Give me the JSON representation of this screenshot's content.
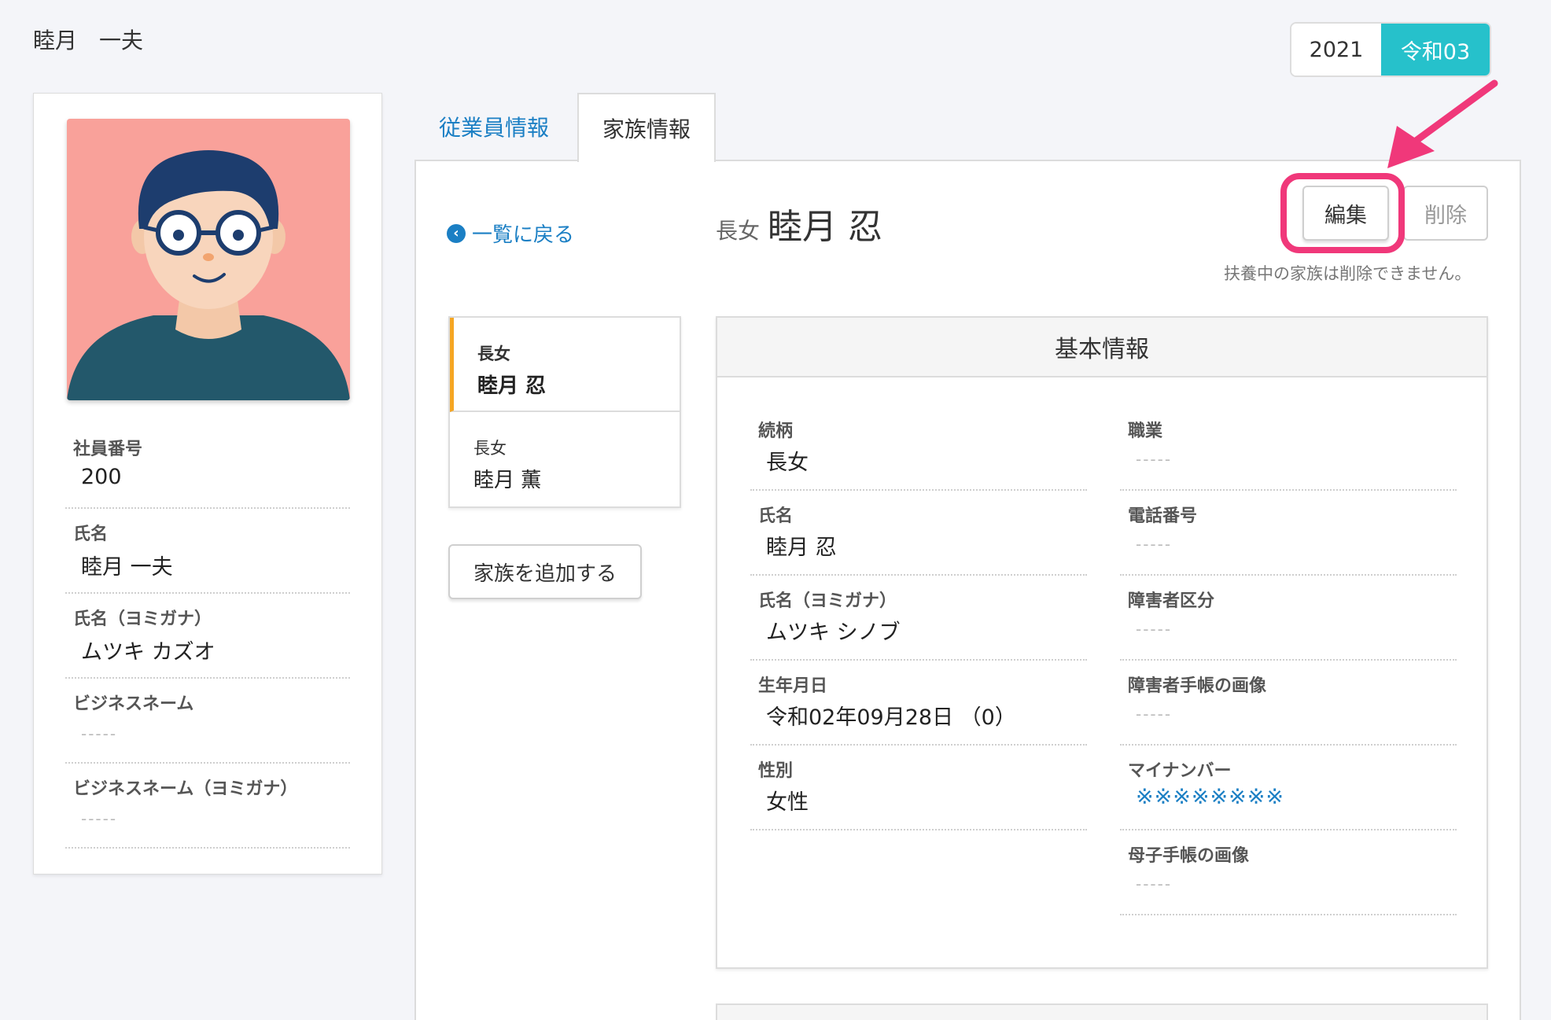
{
  "header": {
    "employee_name": "睦月　一夫"
  },
  "year_toggle": {
    "ad": "2021",
    "jp": "令和03",
    "active_color": "#26c1cb"
  },
  "profile": {
    "avatar_bg": "#f9a19a",
    "fields": [
      {
        "label": "社員番号",
        "value": "200"
      },
      {
        "label": "氏名",
        "value": "睦月 一夫"
      },
      {
        "label": "氏名（ヨミガナ）",
        "value": "ムツキ カズオ"
      },
      {
        "label": "ビジネスネーム",
        "value": "-----"
      },
      {
        "label": "ビジネスネーム（ヨミガナ）",
        "value": "-----"
      }
    ]
  },
  "tabs": [
    {
      "label": "従業員情報",
      "active": false
    },
    {
      "label": "家族情報",
      "active": true
    }
  ],
  "back_link": {
    "label": "一覧に戻る",
    "icon": "arrow-left-circle-icon"
  },
  "family_list": [
    {
      "relation": "長女",
      "name": "睦月 忍",
      "active": true
    },
    {
      "relation": "長女",
      "name": "睦月 薫",
      "active": false
    }
  ],
  "add_family_label": "家族を追加する",
  "detail": {
    "relation": "長女",
    "name": "睦月 忍",
    "edit_label": "編集",
    "delete_label": "削除",
    "note": "扶養中の家族は削除できません。"
  },
  "basic_info": {
    "title": "基本情報",
    "left": [
      {
        "label": "続柄",
        "value": "長女"
      },
      {
        "label": "氏名",
        "value": "睦月 忍"
      },
      {
        "label": "氏名（ヨミガナ）",
        "value": "ムツキ シノブ"
      },
      {
        "label": "生年月日",
        "value": "令和02年09月28日 （0）"
      },
      {
        "label": "性別",
        "value": "女性"
      }
    ],
    "right": [
      {
        "label": "職業",
        "value": "-----"
      },
      {
        "label": "電話番号",
        "value": "-----"
      },
      {
        "label": "障害者区分",
        "value": "-----"
      },
      {
        "label": "障害者手帳の画像",
        "value": "-----"
      },
      {
        "label": "マイナンバー",
        "value": "※※※※※※※※"
      },
      {
        "label": "母子手帳の画像",
        "value": "-----"
      }
    ]
  },
  "annotation_color": "#f0387a"
}
